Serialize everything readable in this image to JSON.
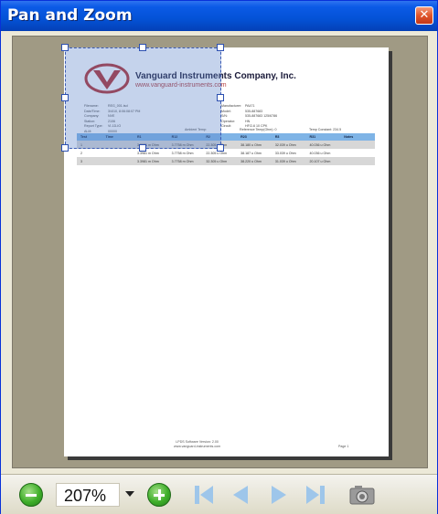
{
  "window": {
    "title": "Pan and Zoom",
    "close_glyph": "✕"
  },
  "report": {
    "company_name": "Vanguard Instruments Company, Inc.",
    "website": "www.vanguard-instruments.com",
    "info_left": [
      {
        "k": "Filename:",
        "v": "REG_001.tsd"
      },
      {
        "k": "Date/Time:",
        "v": "3/4/10, 8:06:08:07 PM"
      },
      {
        "k": "Company:",
        "v": "NVE"
      },
      {
        "k": "Station:",
        "v": "2106"
      },
      {
        "k": "Report Type:",
        "v": "VI-1D-IO"
      },
      {
        "k": "ALM:",
        "v": "00000"
      }
    ],
    "info_right": [
      {
        "k": "Manufacturer:",
        "v": "PA471"
      },
      {
        "k": "Model:",
        "v": "535-887683"
      },
      {
        "k": "S/N:",
        "v": "535-887683 125/6786"
      },
      {
        "k": "Operator:",
        "v": "HN"
      },
      {
        "k": "Circuit:",
        "v": "HF/2-6 10 CPK"
      }
    ],
    "temps": [
      "Ambient Temp: ",
      "Reference Temp(Ohm): 0",
      "Temp Constant: 234.5"
    ],
    "table": {
      "headers": [
        "Test",
        "Time",
        "R1",
        "R12",
        "R2",
        "R23",
        "R3",
        "R31",
        "Notes"
      ],
      "rows": [
        [
          "1",
          "",
          "3.3981 m Ohm",
          "3.7758 m Ohm",
          "22.305 u Ohm",
          "38.180 u Ohm",
          "32.039 u Ohm",
          "40.036 u Ohm",
          ""
        ],
        [
          "2",
          "",
          "3.3981 m Ohm",
          "3.7758 m Ohm",
          "22.305 u Ohm",
          "38.187 u Ohm",
          "33.039 u Ohm",
          "40.036 u Ohm",
          ""
        ],
        [
          "3",
          "",
          "3.3981 m Ohm",
          "3.7758 m Ohm",
          "32.305 u Ohm",
          "38.220 u Ohm",
          "31.039 u Ohm",
          "20.107 u Ohm",
          ""
        ]
      ]
    },
    "footer_lines": [
      "LPDS Software Version: 2.00",
      "www.vanguard-instruments.com"
    ],
    "page_label": "Page 1"
  },
  "toolbar": {
    "zoom_value": "207%",
    "icons": {
      "zoom_out": "minus-circle-icon",
      "zoom_in": "plus-circle-icon",
      "first": "first-page-icon",
      "prev": "prev-page-icon",
      "next": "next-page-icon",
      "last": "last-page-icon",
      "snapshot": "camera-icon"
    }
  },
  "colors": {
    "titlebar": "#0452d6",
    "table_header": "#7fb4e6",
    "selection": "#5a82c8",
    "zoom_buttons": "#3fae2a",
    "nav_disabled": "#9ec6ea"
  }
}
